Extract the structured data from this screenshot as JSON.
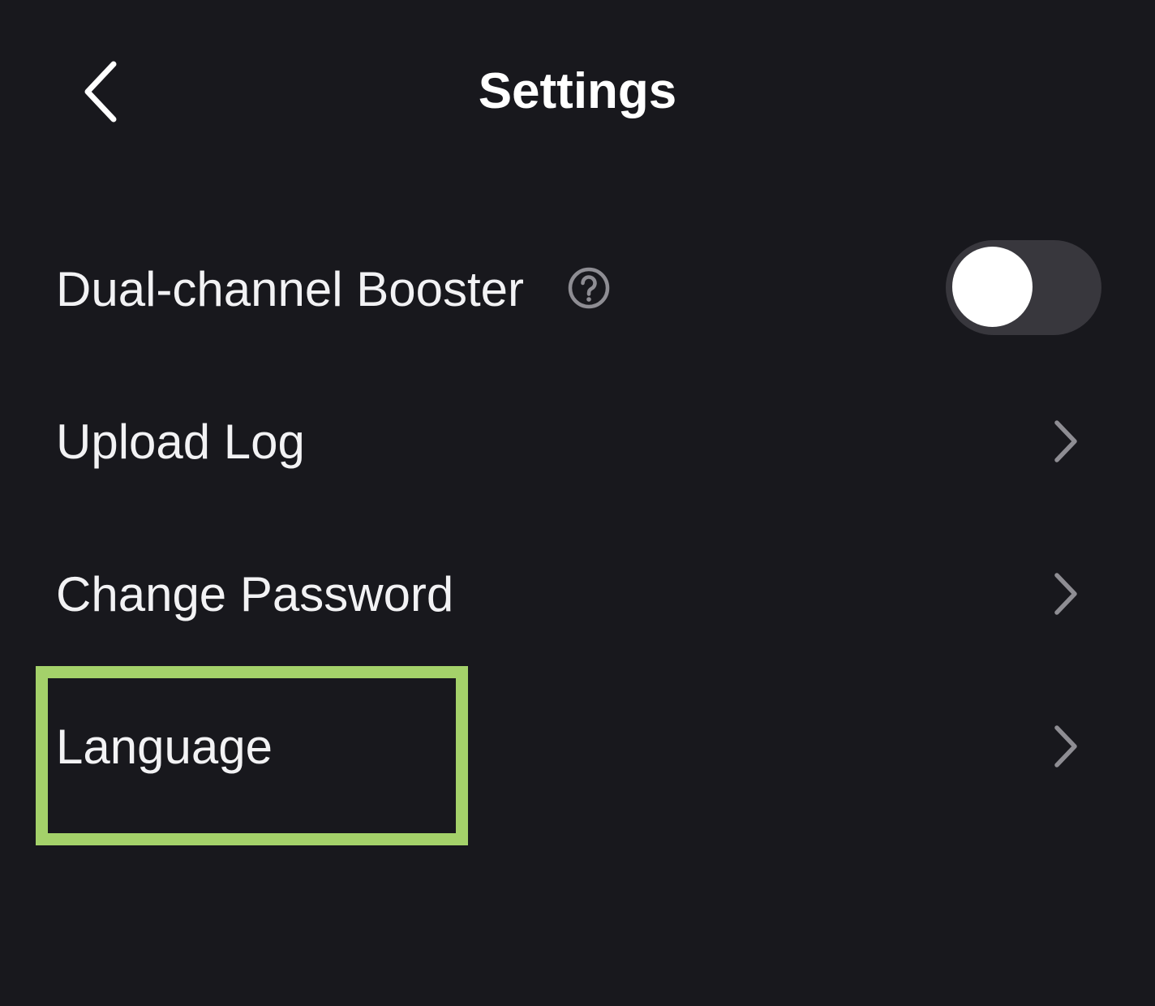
{
  "header": {
    "title": "Settings",
    "back_icon": "chevron-left-icon"
  },
  "settings": {
    "dual_channel_booster": {
      "label": "Dual-channel Booster",
      "help_icon": "question-circle-icon",
      "toggle_on": false
    },
    "upload_log": {
      "label": "Upload Log",
      "icon": "chevron-right-icon"
    },
    "change_password": {
      "label": "Change Password",
      "icon": "chevron-right-icon"
    },
    "language": {
      "label": "Language",
      "icon": "chevron-right-icon"
    }
  },
  "colors": {
    "background": "#18181d",
    "text": "#f2f2f4",
    "chevron": "#8e8d93",
    "toggle_track": "#38373d",
    "toggle_knob": "#ffffff",
    "highlight": "#a4d16a"
  }
}
